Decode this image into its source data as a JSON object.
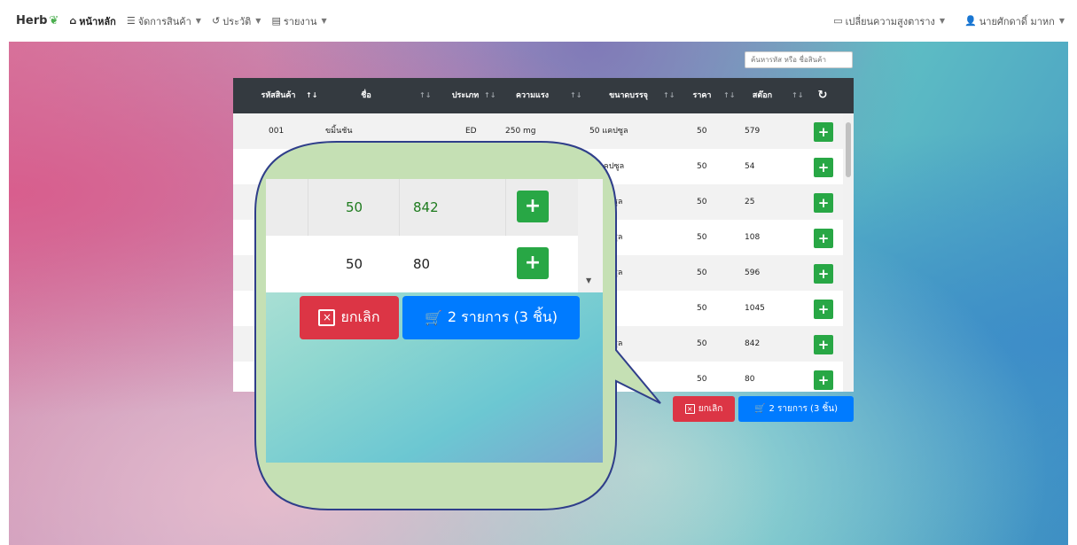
{
  "nav": {
    "brand": "Herb",
    "items": [
      {
        "label": "หน้าหลัก",
        "icon": "home-icon",
        "active": true
      },
      {
        "label": "จัดการสินค้า",
        "icon": "list-icon"
      },
      {
        "label": "ประวัติ",
        "icon": "history-icon"
      },
      {
        "label": "รายงาน",
        "icon": "report-icon"
      }
    ],
    "right": {
      "row_height_label": "เปลี่ยนความสูงตาราง",
      "user_label": "นายศักดาดิ์ มาหก"
    }
  },
  "search": {
    "placeholder": "ค้นหารหัส หรือ ชื่อสินค้า"
  },
  "table": {
    "headers": [
      "รหัสสินค้า",
      "ชื่อ",
      "ประเภท",
      "ความแรง",
      "ขนาดบรรจุ",
      "ราคา",
      "สต๊อก"
    ],
    "rows": [
      {
        "code": "001",
        "name": "ขมิ้นชัน",
        "type": "ED",
        "strength": "250 mg",
        "pack": "50 แคปซูล",
        "price": "50",
        "stock": "579"
      },
      {
        "code": "",
        "name": "",
        "type": "",
        "strength": "",
        "pack": "แคปซูล",
        "price": "50",
        "stock": "54"
      },
      {
        "code": "",
        "name": "",
        "type": "",
        "strength": "",
        "pack": "ปซูล",
        "price": "50",
        "stock": "25"
      },
      {
        "code": "",
        "name": "",
        "type": "",
        "strength": "",
        "pack": "ปซูล",
        "price": "50",
        "stock": "108"
      },
      {
        "code": "",
        "name": "",
        "type": "",
        "strength": "",
        "pack": "ปซูล",
        "price": "50",
        "stock": "596"
      },
      {
        "code": "",
        "name": "",
        "type": "",
        "strength": "",
        "pack": "",
        "price": "50",
        "stock": "1045"
      },
      {
        "code": "",
        "name": "",
        "type": "",
        "strength": "",
        "pack": "ปซูล",
        "price": "50",
        "stock": "842"
      },
      {
        "code": "",
        "name": "",
        "type": "",
        "strength": "",
        "pack": "",
        "price": "50",
        "stock": "80"
      }
    ]
  },
  "actions": {
    "cancel_label": "ยกเลิก",
    "cart_label": "2 รายการ (3 ชิ้น)"
  },
  "zoom": {
    "rows": [
      {
        "price": "50",
        "stock": "842"
      },
      {
        "price": "50",
        "stock": "80"
      }
    ],
    "cancel_label": "ยกเลิก",
    "cart_label": "2 รายการ (3 ชิ้น)"
  },
  "colors": {
    "header_bg": "#343a40",
    "add_green": "#28a745",
    "cancel_red": "#dc3545",
    "cart_blue": "#007bff",
    "callout_fill": "#c5e0b4",
    "callout_stroke": "#2f3e8a"
  }
}
